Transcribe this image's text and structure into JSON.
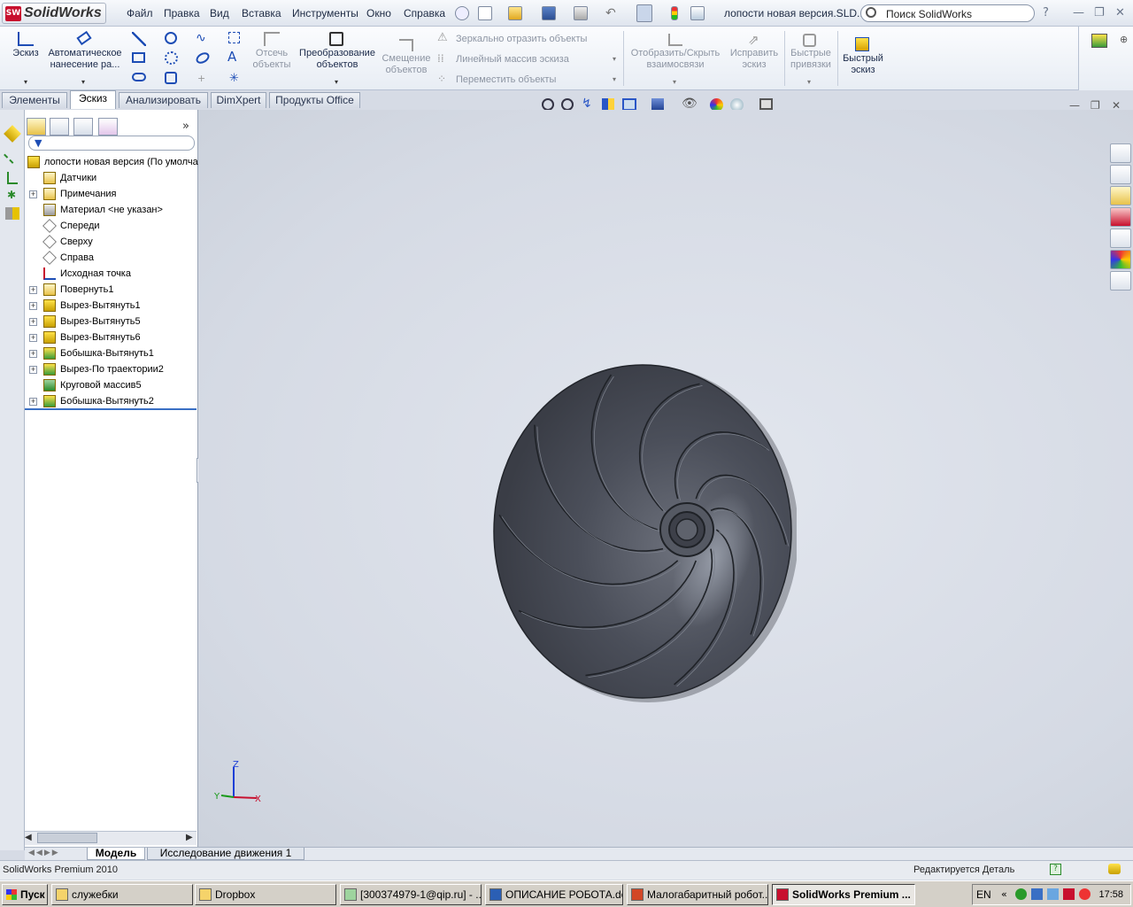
{
  "app": {
    "logo_text": "SolidWorks",
    "logo_badge": "SW",
    "doc_title": "лопости новая версия.SLD..."
  },
  "menu": [
    "Файл",
    "Правка",
    "Вид",
    "Вставка",
    "Инструменты",
    "Окно",
    "Справка"
  ],
  "search": {
    "placeholder": "Поиск SolidWorks"
  },
  "help_label": "?",
  "command_manager": {
    "sketch": "Эскиз",
    "smart_dim_1": "Автоматическое",
    "smart_dim_2": "нанесение ра...",
    "trim_1": "Отсечь",
    "trim_2": "объекты",
    "convert_1": "Преобразование",
    "convert_2": "объектов",
    "offset_1": "Смещение",
    "offset_2": "объектов",
    "mirror": "Зеркально отразить объекты",
    "linear_pattern": "Линейный массив эскиза",
    "move": "Переместить объекты",
    "show_rel_1": "Отобразить/Скрыть",
    "show_rel_2": "взаимосвязи",
    "repair_1": "Исправить",
    "repair_2": "эскиз",
    "snaps_1": "Быстрые",
    "snaps_2": "привязки",
    "rapid_1": "Быстрый",
    "rapid_2": "эскиз"
  },
  "tabs": [
    {
      "label": "Элементы",
      "active": false
    },
    {
      "label": "Эскиз",
      "active": true
    },
    {
      "label": "Анализировать",
      "active": false
    },
    {
      "label": "DimXpert",
      "active": false
    },
    {
      "label": "Продукты Office",
      "active": false
    }
  ],
  "tree": {
    "root": "лопости новая версия  (По умолча",
    "items": [
      {
        "label": "Датчики",
        "icon": "sensor-icon",
        "expandable": false
      },
      {
        "label": "Примечания",
        "icon": "annotation-icon",
        "expandable": true
      },
      {
        "label": "Материал <не указан>",
        "icon": "material-icon",
        "expandable": false
      },
      {
        "label": "Спереди",
        "icon": "plane-icon",
        "expandable": false
      },
      {
        "label": "Сверху",
        "icon": "plane-icon",
        "expandable": false
      },
      {
        "label": "Справа",
        "icon": "plane-icon",
        "expandable": false
      },
      {
        "label": "Исходная точка",
        "icon": "origin-icon",
        "expandable": false
      },
      {
        "label": "Повернуть1",
        "icon": "revolve-icon",
        "expandable": true
      },
      {
        "label": "Вырез-Вытянуть1",
        "icon": "cut-extrude-icon",
        "expandable": true
      },
      {
        "label": "Вырез-Вытянуть5",
        "icon": "cut-extrude-icon",
        "expandable": true
      },
      {
        "label": "Вырез-Вытянуть6",
        "icon": "cut-extrude-icon",
        "expandable": true
      },
      {
        "label": "Бобышка-Вытянуть1",
        "icon": "boss-extrude-icon",
        "expandable": true
      },
      {
        "label": "Вырез-По траектории2",
        "icon": "cut-sweep-icon",
        "expandable": true
      },
      {
        "label": "Круговой массив5",
        "icon": "circular-pattern-icon",
        "expandable": false
      },
      {
        "label": "Бобышка-Вытянуть2",
        "icon": "boss-extrude-icon",
        "expandable": true
      }
    ]
  },
  "bottom_tabs": [
    {
      "label": "Модель",
      "active": true
    },
    {
      "label": "Исследование движения 1",
      "active": false
    }
  ],
  "status": {
    "product": "SolidWorks Premium 2010",
    "mode": "Редактируется Деталь",
    "help": "?"
  },
  "triad": {
    "x": "X",
    "y": "Y",
    "z": "Z"
  },
  "taskbar": {
    "start": "Пуск",
    "tasks": [
      {
        "label": "служебки",
        "active": false
      },
      {
        "label": "Dropbox",
        "active": false
      },
      {
        "label": "[300374979-1@qip.ru] - ...",
        "active": false
      },
      {
        "label": "ОПИСАНИЕ РОБОТА.do...",
        "active": false
      },
      {
        "label": "Малогабаритный робот...",
        "active": false
      },
      {
        "label": "SolidWorks Premium ...",
        "active": true
      }
    ],
    "lang": "EN",
    "clock": "17:58"
  },
  "colors": {
    "accent": "#c8102e",
    "model": "#4a4e58",
    "viewport": "#d8dde6"
  }
}
